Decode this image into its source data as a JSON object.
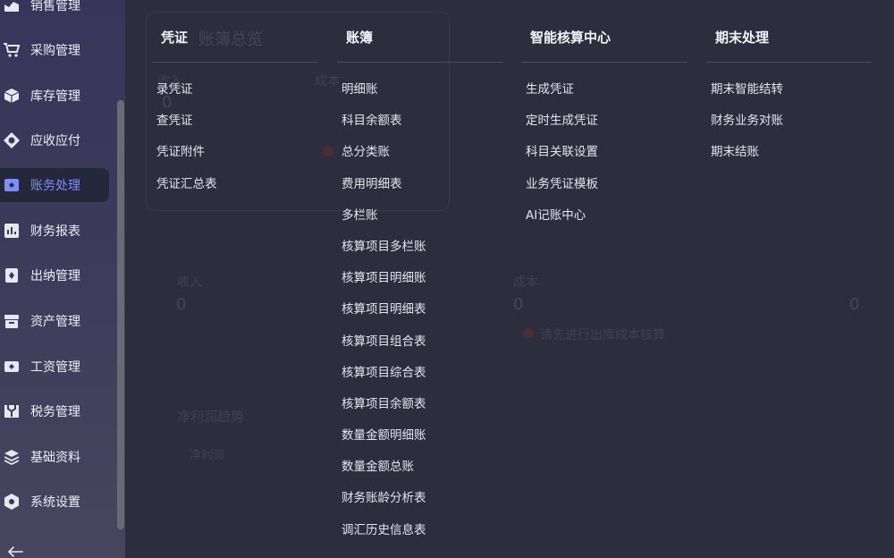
{
  "sidebar": {
    "items": [
      {
        "label": "销售管理",
        "icon": "chart-icon",
        "active": false
      },
      {
        "label": "采购管理",
        "icon": "cart-icon",
        "active": false
      },
      {
        "label": "库存管理",
        "icon": "box-icon",
        "active": false
      },
      {
        "label": "应收应付",
        "icon": "exchange-icon",
        "active": false
      },
      {
        "label": "账务处理",
        "icon": "ledger-icon",
        "active": true
      },
      {
        "label": "财务报表",
        "icon": "report-icon",
        "active": false
      },
      {
        "label": "出纳管理",
        "icon": "cashier-icon",
        "active": false
      },
      {
        "label": "资产管理",
        "icon": "archive-icon",
        "active": false
      },
      {
        "label": "工资管理",
        "icon": "salary-icon",
        "active": false
      },
      {
        "label": "税务管理",
        "icon": "tax-icon",
        "active": false
      },
      {
        "label": "基础资料",
        "icon": "layers-icon",
        "active": false
      },
      {
        "label": "系统设置",
        "icon": "gear-icon",
        "active": false
      }
    ],
    "active_color": "#7d8cff"
  },
  "background": {
    "title": "账簿总览",
    "card_label_1": "收入",
    "card_value_1": "0",
    "card_label_2": "成本",
    "card_value_2": "0",
    "notice": "请先进行出库成本核算",
    "profit_trend": "净利润趋势",
    "profit_select": "净利润"
  },
  "menu": {
    "columns": [
      {
        "title": "凭证",
        "items": [
          "录凭证",
          "查凭证",
          "凭证附件",
          "凭证汇总表"
        ]
      },
      {
        "title": "账簿",
        "items": [
          "明细账",
          "科目余额表",
          "总分类账",
          "费用明细表",
          "多栏账",
          "核算项目多栏账",
          "核算项目明细账",
          "核算项目明细表",
          "核算项目组合表",
          "核算项目综合表",
          "核算项目余额表",
          "数量金额明细账",
          "数量金额总账",
          "财务账龄分析表",
          "调汇历史信息表"
        ]
      },
      {
        "title": "智能核算中心",
        "items": [
          "生成凭证",
          "定时生成凭证",
          "科目关联设置",
          "业务凭证模板",
          "AI记账中心"
        ]
      },
      {
        "title": "期末处理",
        "items": [
          "期末智能结转",
          "财务业务对账",
          "期末结账"
        ]
      }
    ]
  }
}
